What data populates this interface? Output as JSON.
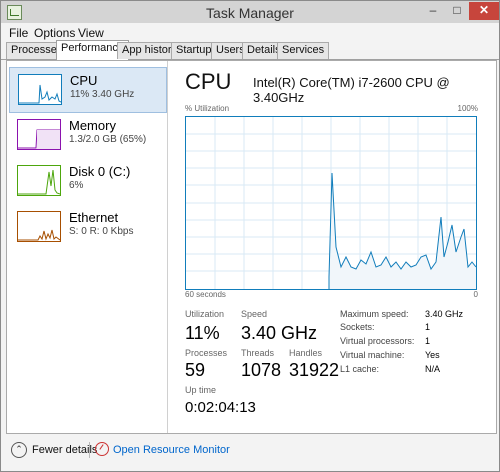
{
  "window": {
    "title": "Task Manager",
    "minimize": "–",
    "maximize": "□",
    "close": "✕"
  },
  "menu": [
    "File",
    "Options",
    "View"
  ],
  "tabs": [
    "Processes",
    "Performance",
    "App history",
    "Startup",
    "Users",
    "Details",
    "Services"
  ],
  "active_tab": "Performance",
  "resources": [
    {
      "name": "CPU",
      "detail": "11% 3.40 GHz",
      "color": "#117dbb"
    },
    {
      "name": "Memory",
      "detail": "1.3/2.0 GB (65%)",
      "color": "#8b12ae"
    },
    {
      "name": "Disk 0 (C:)",
      "detail": "6%",
      "color": "#4da60c"
    },
    {
      "name": "Ethernet",
      "detail": "S: 0 R: 0 Kbps",
      "color": "#a74f01"
    }
  ],
  "cpu": {
    "title": "CPU",
    "model": "Intel(R) Core(TM) i7-2600 CPU @ 3.40GHz",
    "util_label": "% Utilization",
    "max_pct": "100%",
    "seconds": "60 seconds",
    "zero": "0",
    "stats": {
      "utilization_label": "Utilization",
      "utilization": "11%",
      "speed_label": "Speed",
      "speed": "3.40 GHz",
      "processes_label": "Processes",
      "processes": "59",
      "threads_label": "Threads",
      "threads": "1078",
      "handles_label": "Handles",
      "handles": "31922",
      "uptime_label": "Up time",
      "uptime": "0:02:04:13"
    },
    "details": [
      {
        "label": "Maximum speed:",
        "value": "3.40 GHz"
      },
      {
        "label": "Sockets:",
        "value": "1"
      },
      {
        "label": "Virtual processors:",
        "value": "1"
      },
      {
        "label": "Virtual machine:",
        "value": "Yes"
      },
      {
        "label": "L1 cache:",
        "value": "N/A"
      }
    ]
  },
  "footer": {
    "fewer_details": "Fewer details",
    "open_resmon": "Open Resource Monitor"
  }
}
